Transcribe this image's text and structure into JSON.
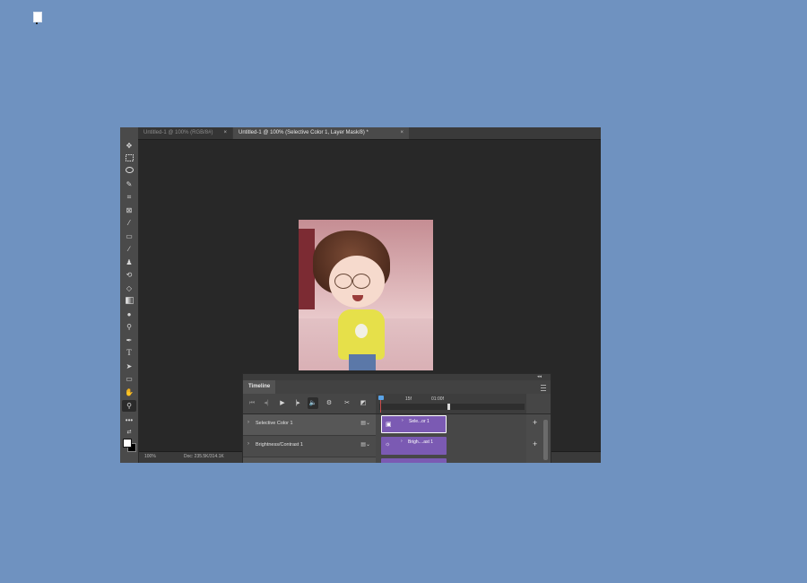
{
  "desktop": {
    "icon": "document-icon"
  },
  "photoshop": {
    "tabs": [
      {
        "label": "Untitled-1 @ 100% (RGB/8#)",
        "active": false
      },
      {
        "label": "Untitled-1 @ 100% (Selective Color 1, Layer Mask/8) *",
        "active": true
      }
    ],
    "tab_close": "×",
    "tools": [
      "move-icon",
      "marquee-icon",
      "lasso-icon",
      "quick-select-icon",
      "crop-icon",
      "frame-icon",
      "eyedropper-icon",
      "healing-brush-icon",
      "brush-icon",
      "clone-stamp-icon",
      "history-brush-icon",
      "eraser-icon",
      "gradient-icon",
      "blur-icon",
      "dodge-icon",
      "pen-icon",
      "type-icon",
      "path-select-icon",
      "rectangle-icon",
      "hand-icon",
      "zoom-icon",
      "more-tools-icon"
    ],
    "type_tool_glyph": "T",
    "status": {
      "zoom": "100%",
      "doc": "Doc: 235.5K/314.1K"
    }
  },
  "timeline": {
    "title": "Timeline",
    "ruler": {
      "mark1": "15f",
      "mark2": "01:00f"
    },
    "layers": [
      {
        "name": "Selective Color 1",
        "clip_label": "Sele...or 1"
      },
      {
        "name": "Brightness/Contrast 1",
        "clip_label": "Brigh....ast 1"
      }
    ],
    "add": "+",
    "chev": "›"
  }
}
